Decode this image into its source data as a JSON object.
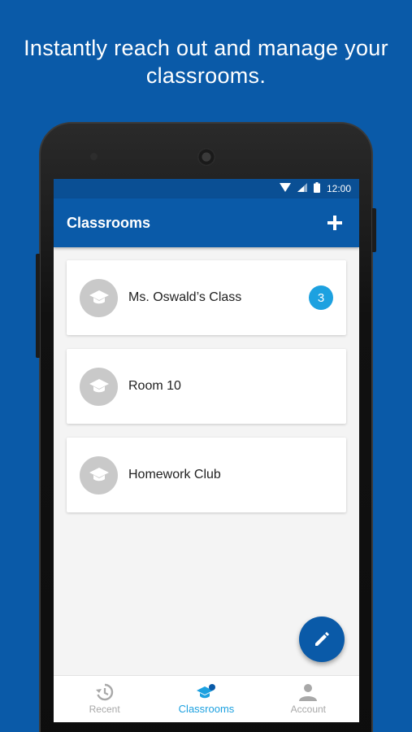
{
  "headline": "Instantly reach out and manage your classrooms.",
  "status_bar": {
    "time": "12:00",
    "icons": [
      "wifi-icon",
      "signal-icon",
      "battery-icon"
    ]
  },
  "app_bar": {
    "title": "Classrooms",
    "add_icon": "plus-icon"
  },
  "classrooms": [
    {
      "name": "Ms. Oswald’s Class",
      "badge": "3"
    },
    {
      "name": "Room 10",
      "badge": ""
    },
    {
      "name": "Homework Club",
      "badge": ""
    }
  ],
  "fab": {
    "icon": "pencil-icon"
  },
  "bottom_nav": [
    {
      "label": "Recent",
      "icon": "history-icon",
      "active": false
    },
    {
      "label": "Classrooms",
      "icon": "graduation-cap-icon",
      "active": true
    },
    {
      "label": "Account",
      "icon": "person-icon",
      "active": false
    }
  ],
  "colors": {
    "brand_blue": "#0a5aa8",
    "status_blue": "#0a4f94",
    "badge_blue": "#1da1e0",
    "screen_bg": "#f4f4f4",
    "avatar_gray": "#c9c9c9"
  }
}
